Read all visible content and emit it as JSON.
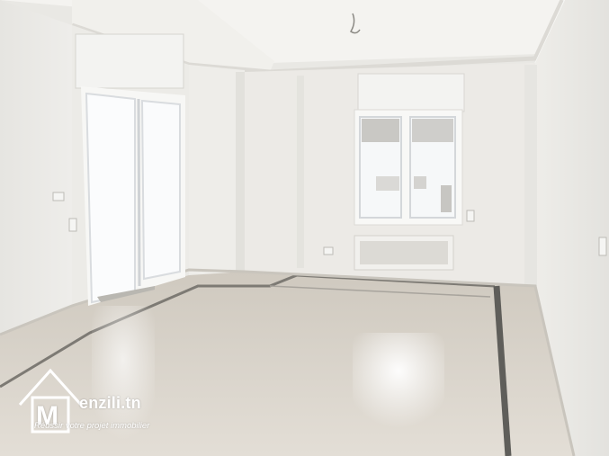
{
  "photo": {
    "subject": "empty-apartment-room",
    "palette": {
      "wall": "#ecebe7",
      "ceiling": "#f4f3f0",
      "floor": "#d8d2c8",
      "floor_border": "#6b6a66",
      "window_light": "#fbfcfd",
      "trim": "#f7f7f5"
    }
  },
  "watermark": {
    "brand_text": "enzili.tn",
    "tagline": "Réussir votre projet immobilier",
    "logo_letter": "M",
    "color": "#ffffff"
  }
}
